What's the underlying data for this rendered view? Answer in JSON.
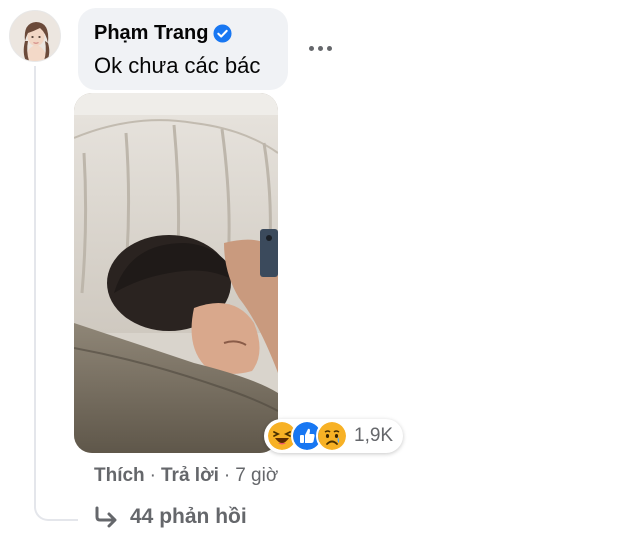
{
  "comment": {
    "author": "Phạm Trang",
    "text": "Ok chưa các bác",
    "verified": true,
    "avatar_icon": "profile-photo-avatar",
    "attachment_icon": "photo-attachment",
    "reactions": {
      "icons": [
        "haha-reaction-icon",
        "like-reaction-icon",
        "sad-reaction-icon"
      ],
      "count": "1,9K"
    },
    "actions": {
      "like": "Thích",
      "separator": "·",
      "reply": "Trả lời",
      "time": "7 giờ"
    },
    "replies_label": "44 phản hồi"
  },
  "colors": {
    "bubble": "#f0f2f5",
    "verified_blue": "#1877f2",
    "muted_text": "#65676b",
    "haha_yellow": "#f7b125",
    "like_blue": "#1877f2",
    "thread_line": "#e4e6eb"
  }
}
